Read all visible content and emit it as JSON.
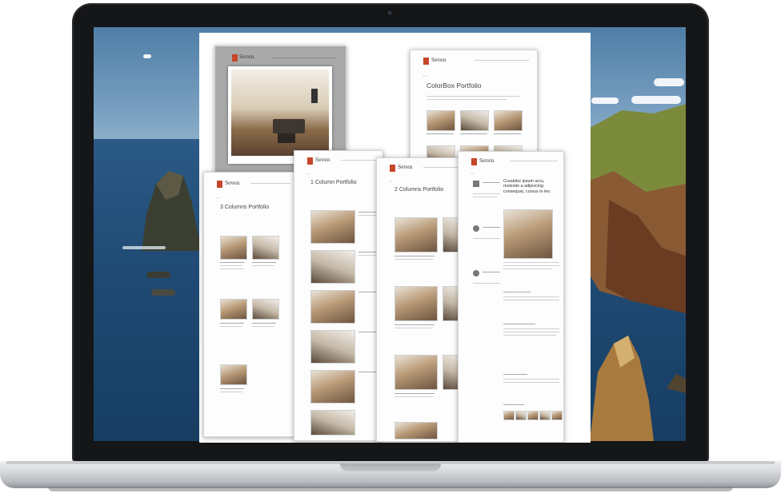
{
  "window": {
    "kind": "laptop-with-portfolio-collage"
  },
  "brand": {
    "logo_glyph": "7",
    "name": "Seven",
    "accent": "#c6462a"
  },
  "pages": {
    "colorbox": {
      "title": "ColorBox Portfolio"
    },
    "one_column": {
      "title": "1 Column Portfolio"
    },
    "two_columns": {
      "title": "2 Columns Portfolio"
    },
    "three_columns": {
      "title": "3 Columns Portfolio"
    },
    "blog": {
      "title": "Curabitur ipsum arcu, molestie a adipiscing consequat, cursus in leo."
    }
  }
}
